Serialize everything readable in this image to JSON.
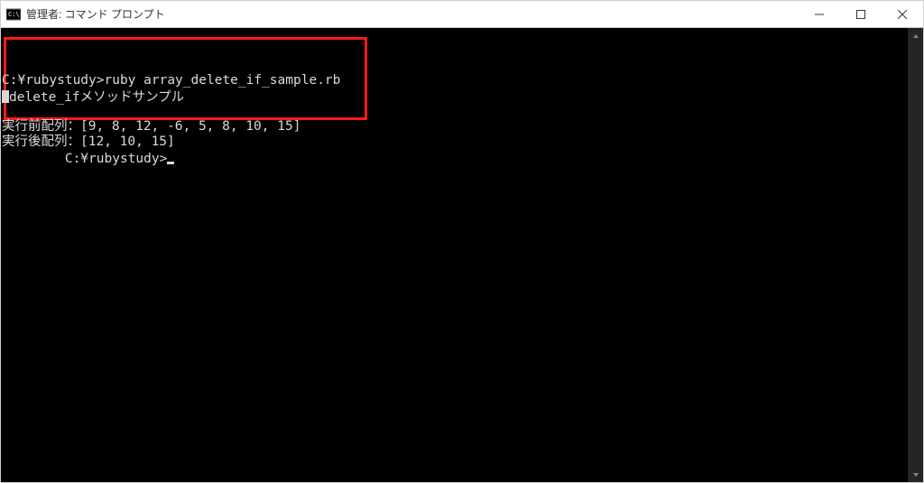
{
  "window": {
    "title": "管理者: コマンド プロンプト"
  },
  "terminal": {
    "line1_prompt_and_cmd": "C:¥rubystudy>ruby array_delete_if_sample.rb",
    "line2_output": "delete_ifメソッドサンプル",
    "line3_blank": "",
    "line4_before": "実行前配列：[9, 8, 12, -6, 5, 8, 10, 15]",
    "line5_after": "実行後配列：[12, 10, 15]",
    "prompt2": "C:¥rubystudy>"
  }
}
